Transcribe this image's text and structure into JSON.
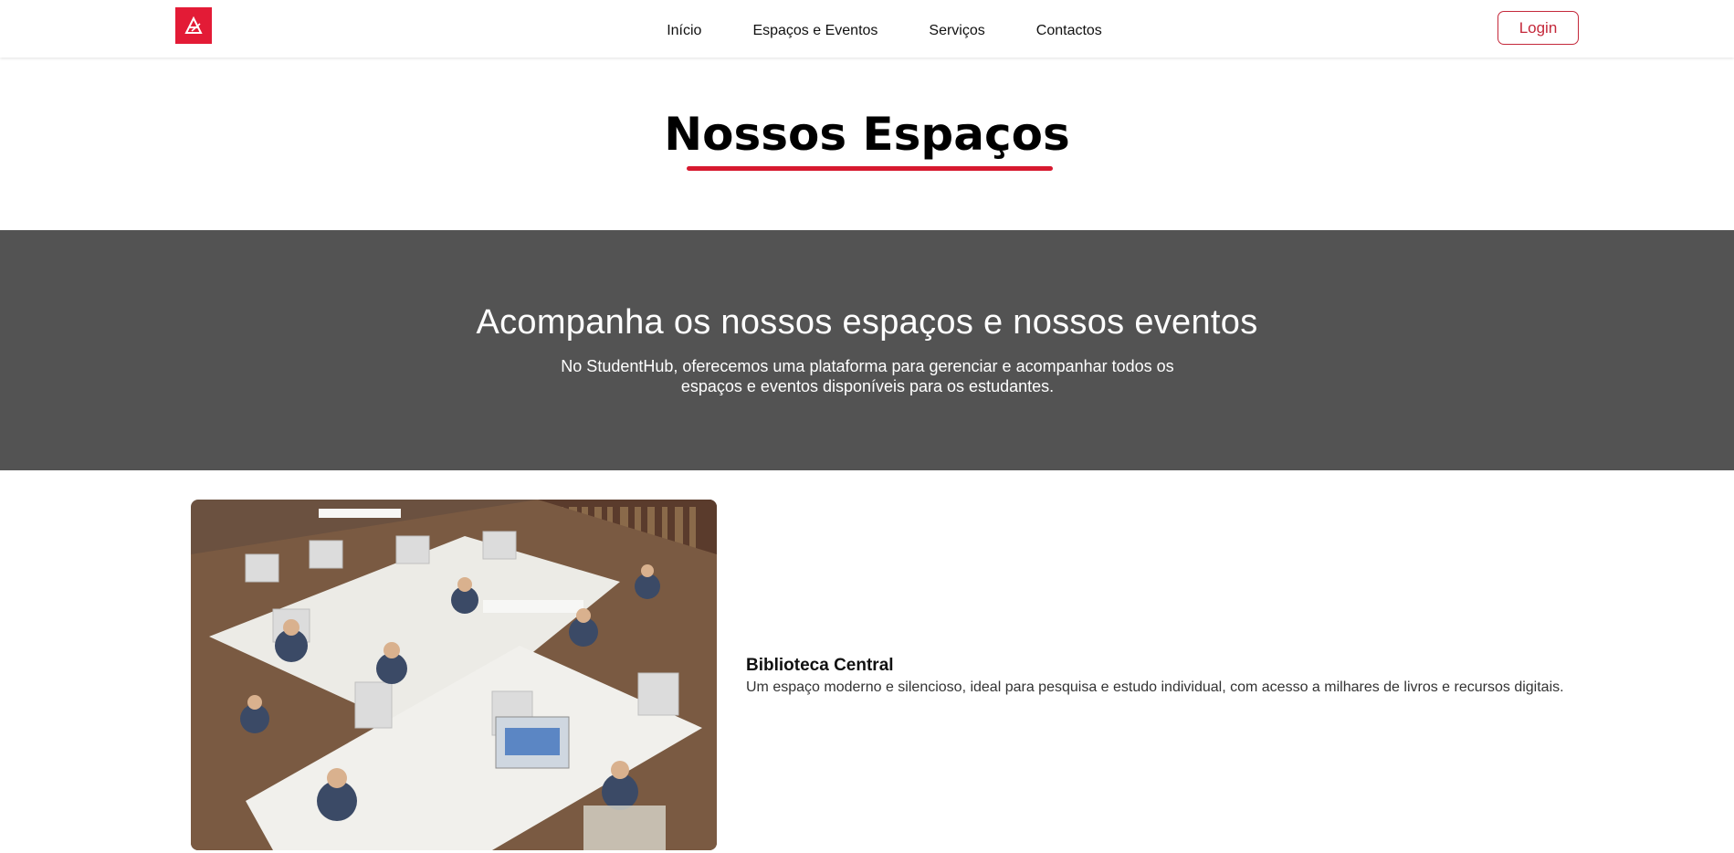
{
  "nav": {
    "logo_icon": "studenthub-logo-icon",
    "links": [
      "Início",
      "Espaços e Eventos",
      "Serviços",
      "Contactos"
    ],
    "login_label": "Login"
  },
  "page": {
    "title": "Nossos Espaços"
  },
  "banner": {
    "heading": "Acompanha os nossos espaços e nossos eventos",
    "text": "No StudentHub, oferecemos uma plataforma para gerenciar e acompanhar todos os espaços e eventos disponíveis para os estudantes."
  },
  "spaces": [
    {
      "name": "Biblioteca Central",
      "description": "Um espaço moderno e silencioso, ideal para pesquisa e estudo individual, com acesso a milhares de livros e recursos digitais."
    }
  ],
  "colors": {
    "accent": "#d7192f",
    "banner_bg": "#535353",
    "logo_bg": "#e31b36"
  }
}
